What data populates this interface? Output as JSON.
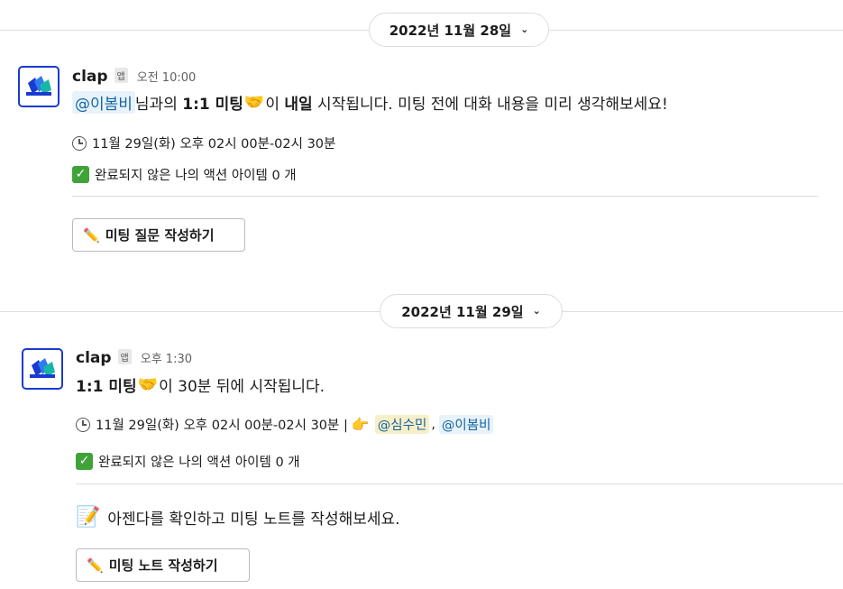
{
  "dates": {
    "first": "2022년 11월 28일",
    "second": "2022년 11월 29일",
    "chevron": "⌄"
  },
  "messages": [
    {
      "sender": "clap",
      "badge": "앱",
      "time": "오전 10:00",
      "line1": {
        "mention": "@이봄비",
        "t1": "님과의 ",
        "meeting": "1:1 미팅",
        "emoji": "🤝",
        "t2": "이 ",
        "tomorrow": "내일",
        "t3": " 시작됩니다. 미팅 전에 대화 내용을 미리 생각해보세요!"
      },
      "schedule": "11월 29일(화) 오후 02시 00분-02시 30분",
      "actions": "완료되지 않은 나의 액션 아이템 0 개",
      "button": "미팅 질문 작성하기"
    },
    {
      "sender": "clap",
      "badge": "앱",
      "time": "오후 1:30",
      "line1": {
        "meeting": "1:1 미팅",
        "emoji": "🤝",
        "t1": "이 30분 뒤에 시작됩니다."
      },
      "schedule": "11월 29일(화) 오후 02시 00분-02시 30분 |",
      "attendees": [
        "@심수민",
        "@이봄비"
      ],
      "attendee_sep": ",",
      "actions": "완료되지 않은 나의 액션 아이템 0 개",
      "agenda": "아젠다를 확인하고 미팅 노트를 작성해보세요.",
      "button": "미팅 노트 작성하기"
    }
  ],
  "icons": {
    "clock": "clock-icon",
    "check": "✓",
    "pencil": "✏️",
    "memo": "📝",
    "point": "👉",
    "logo": "clap-logo-icon"
  },
  "colors": {
    "mention_bg": "#e8f2fb",
    "mention_self_bg": "#f8efc8",
    "mention_text": "#1264a3",
    "avatar_border": "#1a3bd1"
  }
}
